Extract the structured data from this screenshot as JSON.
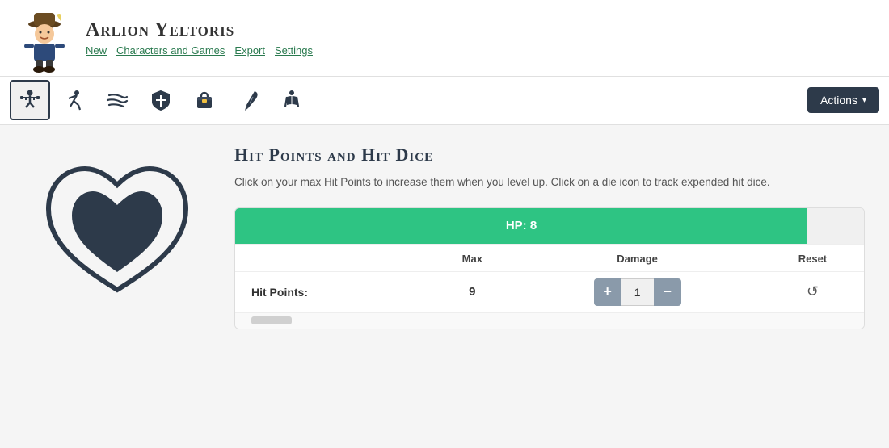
{
  "header": {
    "title": "Arlion Yeltoris",
    "nav": {
      "new_label": "New",
      "characters_label": "Characters and Games",
      "export_label": "Export",
      "settings_label": "Settings"
    }
  },
  "toolbar": {
    "icons": [
      {
        "name": "exercises-icon",
        "symbol": "🏋",
        "active": true,
        "label": "Exercises"
      },
      {
        "name": "combat-icon",
        "symbol": "🏃",
        "active": false,
        "label": "Combat"
      },
      {
        "name": "magic-icon",
        "symbol": "💨",
        "active": false,
        "label": "Magic"
      },
      {
        "name": "shield-icon",
        "symbol": "🛡",
        "active": false,
        "label": "Shield"
      },
      {
        "name": "bag-icon",
        "symbol": "🎒",
        "active": false,
        "label": "Bag"
      },
      {
        "name": "quill-icon",
        "symbol": "🖊",
        "active": false,
        "label": "Quill"
      },
      {
        "name": "reading-icon",
        "symbol": "📖",
        "active": false,
        "label": "Reading"
      }
    ],
    "actions_label": "Actions"
  },
  "section": {
    "title": "Hit Points and Hit Dice",
    "description": "Click on your max Hit Points to increase them when you level up. Click on a die icon to track expended hit dice.",
    "hp_bar": {
      "label": "HP: 8",
      "fill_percent": 91
    },
    "table": {
      "columns": [
        "",
        "Max",
        "Damage",
        "Reset"
      ],
      "rows": [
        {
          "label": "Hit Points:",
          "max_value": "9",
          "damage_value": "1",
          "has_reset": true
        }
      ]
    }
  },
  "icons": {
    "plus": "+",
    "minus": "−",
    "reset": "↺",
    "caret": "▾"
  }
}
